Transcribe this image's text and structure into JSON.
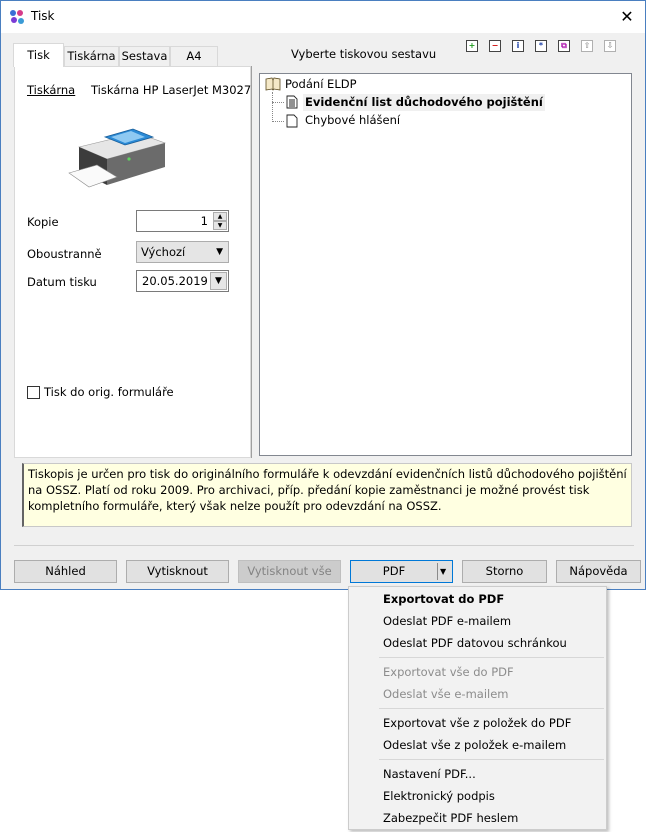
{
  "window": {
    "title": "Tisk"
  },
  "tabs": [
    {
      "label": "Tisk"
    },
    {
      "label": "Tiskárna"
    },
    {
      "label": "Sestava"
    },
    {
      "label": "A4"
    }
  ],
  "printer": {
    "label": "Tiskárna",
    "name": "Tiskárna HP LaserJet M3027"
  },
  "copies": {
    "label": "Kopie",
    "value": "1"
  },
  "duplex": {
    "label": "Oboustranně",
    "value": "Výchozí"
  },
  "print_date": {
    "label": "Datum tisku",
    "value": "20.05.2019"
  },
  "orig_form": {
    "label": "Tisk do orig. formuláře",
    "checked": false
  },
  "report_header": "Vyberte tiskovou sestavu",
  "tree": {
    "root": "Podání ELDP",
    "children": [
      {
        "label": "Evidenční list důchodového pojištění",
        "selected": true
      },
      {
        "label": "Chybové hlášení",
        "selected": false
      }
    ]
  },
  "toolbar": {
    "add": "+",
    "remove": "−",
    "info": "i",
    "star": "*",
    "copy": "⧉",
    "up": "⇧",
    "down": "⇩"
  },
  "info_text": "Tiskopis je určen pro tisk do originálního formuláře k odevzdání evidenčních listů důchodového pojištění na OSSZ. Platí od roku 2009. Pro archivaci, příp. předání kopie zaměstnanci je možné provést tisk kompletního formuláře, který však nelze použít pro odevzdání na OSSZ.",
  "buttons": {
    "preview": "Náhled",
    "print": "Vytisknout",
    "print_all": "Vytisknout vše",
    "pdf": "PDF",
    "cancel": "Storno",
    "help": "Nápověda"
  },
  "pdf_menu": [
    {
      "label": "Exportovat do PDF",
      "bold": true,
      "disabled": false
    },
    {
      "label": "Odeslat PDF e-mailem",
      "bold": false,
      "disabled": false
    },
    {
      "label": "Odeslat PDF datovou schránkou",
      "bold": false,
      "disabled": false
    },
    {
      "label": "Exportovat vše do PDF",
      "bold": false,
      "disabled": true
    },
    {
      "label": "Odeslat vše e-mailem",
      "bold": false,
      "disabled": true
    },
    {
      "label": "Exportovat vše z položek do PDF",
      "bold": false,
      "disabled": false
    },
    {
      "label": "Odeslat vše z položek e-mailem",
      "bold": false,
      "disabled": false
    },
    {
      "label": "Nastavení PDF...",
      "bold": false,
      "disabled": false
    },
    {
      "label": "Elektronický podpis",
      "bold": false,
      "disabled": false
    },
    {
      "label": "Zabezpečit PDF heslem",
      "bold": false,
      "disabled": false
    }
  ],
  "colors": {
    "accent": "#0078d7",
    "info_bg": "#ffffe1",
    "window_border": "#4a7fc0"
  }
}
